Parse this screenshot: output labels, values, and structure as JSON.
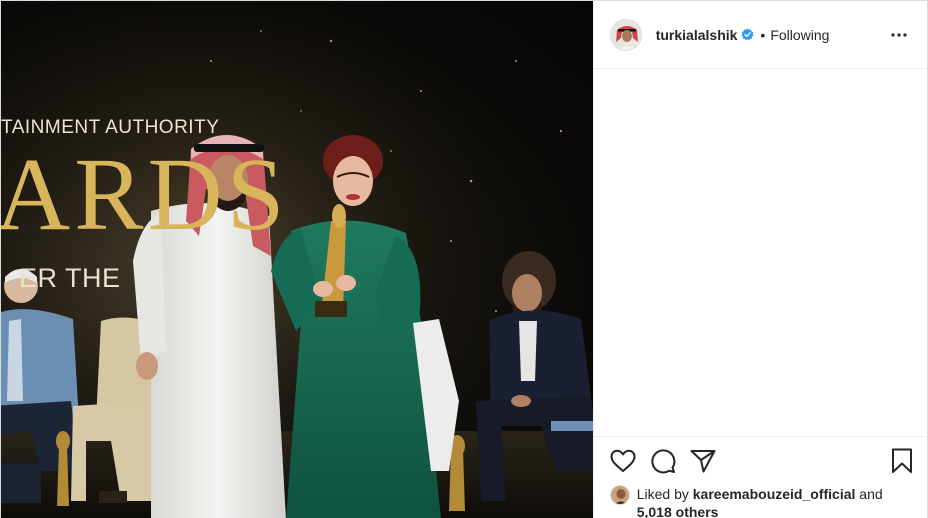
{
  "post": {
    "photo": {
      "banner_line1": "TAINMENT AUTHORITY",
      "banner_line2": "ARDS",
      "banner_line3": "ER THE"
    },
    "header": {
      "username": "turkialalshik",
      "separator": "•",
      "follow_label": "Following",
      "avatar_icon": "profile-photo",
      "verified_icon": "verified-badge-icon",
      "more_icon": "ellipsis-icon"
    },
    "actions": {
      "like_icon": "heart-icon",
      "comment_icon": "speech-bubble-icon",
      "share_icon": "paper-plane-icon",
      "save_icon": "bookmark-icon"
    },
    "likes": {
      "prefix": "Liked by",
      "liker": "kareemabouzeid_official",
      "conjunction": "and",
      "others": "5,018 others"
    }
  },
  "colors": {
    "verified_blue": "#3897f0",
    "text": "#262626",
    "border": "#efefef"
  }
}
